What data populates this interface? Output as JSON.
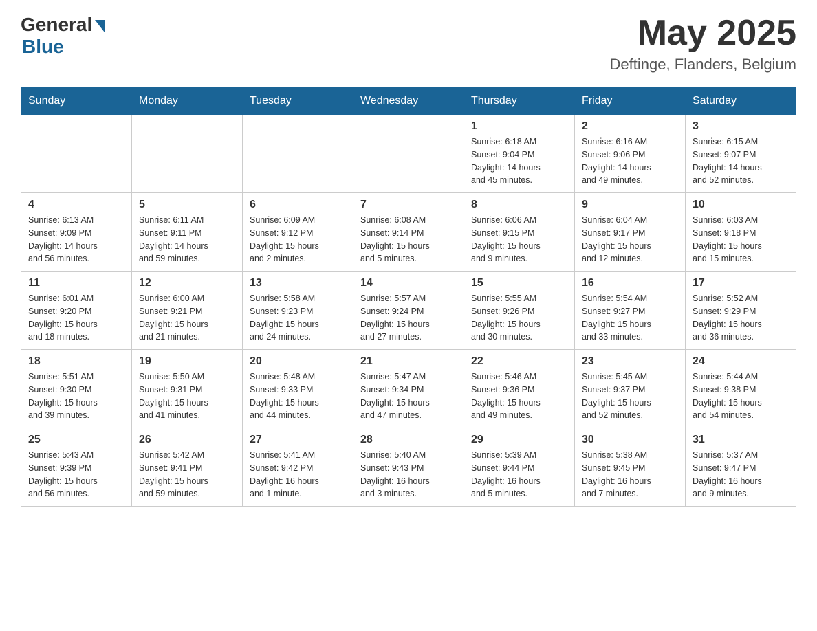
{
  "header": {
    "logo_general": "General",
    "logo_blue": "Blue",
    "month_title": "May 2025",
    "location": "Deftinge, Flanders, Belgium"
  },
  "days_of_week": [
    "Sunday",
    "Monday",
    "Tuesday",
    "Wednesday",
    "Thursday",
    "Friday",
    "Saturday"
  ],
  "weeks": [
    [
      {
        "day": "",
        "info": ""
      },
      {
        "day": "",
        "info": ""
      },
      {
        "day": "",
        "info": ""
      },
      {
        "day": "",
        "info": ""
      },
      {
        "day": "1",
        "info": "Sunrise: 6:18 AM\nSunset: 9:04 PM\nDaylight: 14 hours\nand 45 minutes."
      },
      {
        "day": "2",
        "info": "Sunrise: 6:16 AM\nSunset: 9:06 PM\nDaylight: 14 hours\nand 49 minutes."
      },
      {
        "day": "3",
        "info": "Sunrise: 6:15 AM\nSunset: 9:07 PM\nDaylight: 14 hours\nand 52 minutes."
      }
    ],
    [
      {
        "day": "4",
        "info": "Sunrise: 6:13 AM\nSunset: 9:09 PM\nDaylight: 14 hours\nand 56 minutes."
      },
      {
        "day": "5",
        "info": "Sunrise: 6:11 AM\nSunset: 9:11 PM\nDaylight: 14 hours\nand 59 minutes."
      },
      {
        "day": "6",
        "info": "Sunrise: 6:09 AM\nSunset: 9:12 PM\nDaylight: 15 hours\nand 2 minutes."
      },
      {
        "day": "7",
        "info": "Sunrise: 6:08 AM\nSunset: 9:14 PM\nDaylight: 15 hours\nand 5 minutes."
      },
      {
        "day": "8",
        "info": "Sunrise: 6:06 AM\nSunset: 9:15 PM\nDaylight: 15 hours\nand 9 minutes."
      },
      {
        "day": "9",
        "info": "Sunrise: 6:04 AM\nSunset: 9:17 PM\nDaylight: 15 hours\nand 12 minutes."
      },
      {
        "day": "10",
        "info": "Sunrise: 6:03 AM\nSunset: 9:18 PM\nDaylight: 15 hours\nand 15 minutes."
      }
    ],
    [
      {
        "day": "11",
        "info": "Sunrise: 6:01 AM\nSunset: 9:20 PM\nDaylight: 15 hours\nand 18 minutes."
      },
      {
        "day": "12",
        "info": "Sunrise: 6:00 AM\nSunset: 9:21 PM\nDaylight: 15 hours\nand 21 minutes."
      },
      {
        "day": "13",
        "info": "Sunrise: 5:58 AM\nSunset: 9:23 PM\nDaylight: 15 hours\nand 24 minutes."
      },
      {
        "day": "14",
        "info": "Sunrise: 5:57 AM\nSunset: 9:24 PM\nDaylight: 15 hours\nand 27 minutes."
      },
      {
        "day": "15",
        "info": "Sunrise: 5:55 AM\nSunset: 9:26 PM\nDaylight: 15 hours\nand 30 minutes."
      },
      {
        "day": "16",
        "info": "Sunrise: 5:54 AM\nSunset: 9:27 PM\nDaylight: 15 hours\nand 33 minutes."
      },
      {
        "day": "17",
        "info": "Sunrise: 5:52 AM\nSunset: 9:29 PM\nDaylight: 15 hours\nand 36 minutes."
      }
    ],
    [
      {
        "day": "18",
        "info": "Sunrise: 5:51 AM\nSunset: 9:30 PM\nDaylight: 15 hours\nand 39 minutes."
      },
      {
        "day": "19",
        "info": "Sunrise: 5:50 AM\nSunset: 9:31 PM\nDaylight: 15 hours\nand 41 minutes."
      },
      {
        "day": "20",
        "info": "Sunrise: 5:48 AM\nSunset: 9:33 PM\nDaylight: 15 hours\nand 44 minutes."
      },
      {
        "day": "21",
        "info": "Sunrise: 5:47 AM\nSunset: 9:34 PM\nDaylight: 15 hours\nand 47 minutes."
      },
      {
        "day": "22",
        "info": "Sunrise: 5:46 AM\nSunset: 9:36 PM\nDaylight: 15 hours\nand 49 minutes."
      },
      {
        "day": "23",
        "info": "Sunrise: 5:45 AM\nSunset: 9:37 PM\nDaylight: 15 hours\nand 52 minutes."
      },
      {
        "day": "24",
        "info": "Sunrise: 5:44 AM\nSunset: 9:38 PM\nDaylight: 15 hours\nand 54 minutes."
      }
    ],
    [
      {
        "day": "25",
        "info": "Sunrise: 5:43 AM\nSunset: 9:39 PM\nDaylight: 15 hours\nand 56 minutes."
      },
      {
        "day": "26",
        "info": "Sunrise: 5:42 AM\nSunset: 9:41 PM\nDaylight: 15 hours\nand 59 minutes."
      },
      {
        "day": "27",
        "info": "Sunrise: 5:41 AM\nSunset: 9:42 PM\nDaylight: 16 hours\nand 1 minute."
      },
      {
        "day": "28",
        "info": "Sunrise: 5:40 AM\nSunset: 9:43 PM\nDaylight: 16 hours\nand 3 minutes."
      },
      {
        "day": "29",
        "info": "Sunrise: 5:39 AM\nSunset: 9:44 PM\nDaylight: 16 hours\nand 5 minutes."
      },
      {
        "day": "30",
        "info": "Sunrise: 5:38 AM\nSunset: 9:45 PM\nDaylight: 16 hours\nand 7 minutes."
      },
      {
        "day": "31",
        "info": "Sunrise: 5:37 AM\nSunset: 9:47 PM\nDaylight: 16 hours\nand 9 minutes."
      }
    ]
  ]
}
